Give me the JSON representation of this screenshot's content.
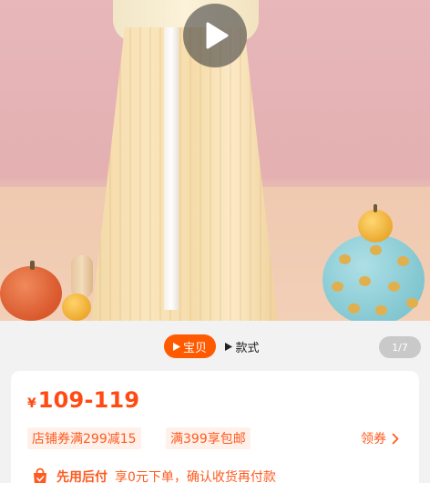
{
  "media": {
    "play_icon": "play-icon",
    "counter": "1/7"
  },
  "gallery_tabs": [
    {
      "label": "宝贝",
      "icon": "play-triangle-icon",
      "active": true
    },
    {
      "label": "款式",
      "icon": "play-triangle-icon",
      "active": false
    }
  ],
  "price": {
    "currency": "¥",
    "range": "109-119"
  },
  "promotions": {
    "tags": [
      "店铺券满299减15",
      "满399享包邮"
    ],
    "coupon_link": "领券",
    "coupon_arrow_icon": "chevron-right-icon"
  },
  "pay_later": {
    "icon": "shopping-bag-icon",
    "label": "先用后付",
    "description": "享0元下单，确认收货再付款"
  },
  "colors": {
    "accent": "#ff5a00",
    "price": "#ff4a13",
    "tag_bg": "#fff1ea"
  }
}
